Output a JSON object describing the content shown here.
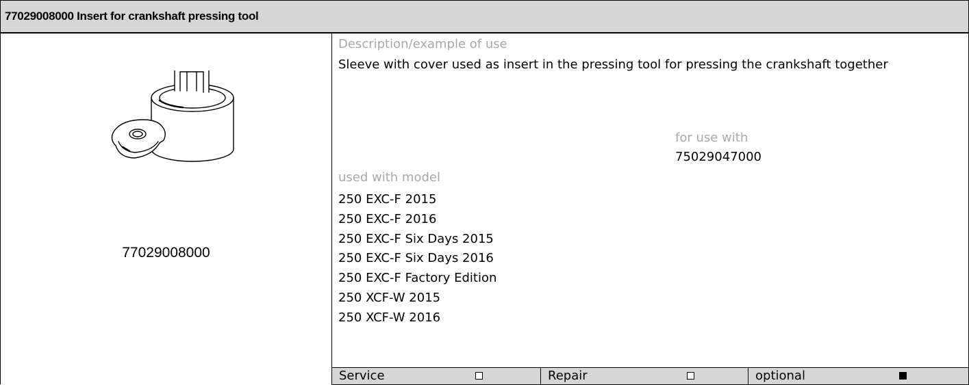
{
  "header": {
    "title": "77029008000 Insert for crankshaft pressing tool"
  },
  "part": {
    "number": "77029008000",
    "illustration_icon": "sleeve-with-cover-icon"
  },
  "description": {
    "label": "Description/example of use",
    "text": "Sleeve with cover used as insert in the pressing tool for pressing the crankshaft together"
  },
  "for_use_with": {
    "label": "for use with",
    "value": "75029047000"
  },
  "models": {
    "label": "used with model",
    "items": [
      "250 EXC-F 2015",
      "250 EXC-F 2016",
      "250 EXC-F Six Days 2015",
      "250 EXC-F Six Days 2016",
      "250 EXC-F Factory Edition",
      "250 XCF-W 2015",
      "250 XCF-W 2016"
    ]
  },
  "footer": [
    {
      "label": "Service",
      "checked": false
    },
    {
      "label": "Repair",
      "checked": false
    },
    {
      "label": "optional",
      "checked": true
    }
  ],
  "colors": {
    "header_bg": "#d6d6d6",
    "label_grey": "#a8a8a8"
  }
}
